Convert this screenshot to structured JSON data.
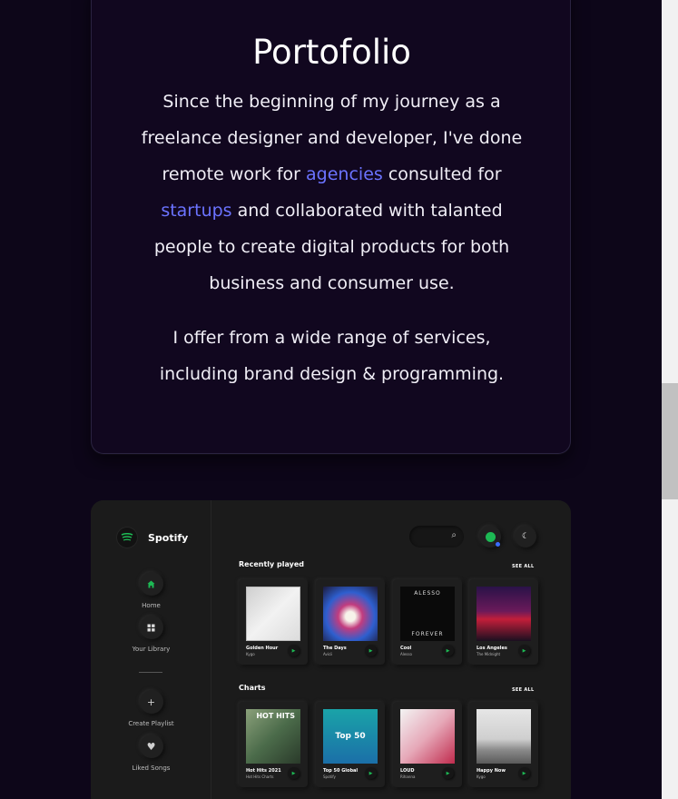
{
  "intro": {
    "title": "Portofolio",
    "p1_part1": "Since the beginning of my journey as a freelance designer and developer, I've done remote work for ",
    "link_agencies": "agencies",
    "p1_part2": " consulted for ",
    "link_startups": "startups",
    "p1_part3": " and collaborated with talanted people to create digital products for both business and consumer use.",
    "p2": "I offer from a wide range of services, including brand design & programming."
  },
  "colors": {
    "background": "#0d0619",
    "card": "#11071f",
    "link": "#6b73ff",
    "spotify_green": "#1db954",
    "mockup_bg": "#1b1b1b"
  },
  "spotify": {
    "logo_text": "Spotify",
    "logo_icon": "spotify-logo-icon",
    "nav": [
      {
        "label": "Home",
        "icon": "home-icon"
      },
      {
        "label": "Your Library",
        "icon": "library-icon"
      },
      {
        "label": "Create Playlist",
        "icon": "plus-icon"
      },
      {
        "label": "Liked Songs",
        "icon": "heart-icon"
      }
    ],
    "search_icon": "search-icon",
    "theme_icon": "moon-icon",
    "recently_played": {
      "title": "Recently played",
      "see_all": "SEE ALL",
      "items": [
        {
          "title": "Golden Hour",
          "sub": "Kygo"
        },
        {
          "title": "The Days",
          "sub": "Avicii"
        },
        {
          "title": "Cool",
          "sub": "Alesso",
          "cover_top": "ALESSO",
          "cover_bottom": "FOREVER"
        },
        {
          "title": "Los Angeles",
          "sub": "The Midnight"
        }
      ]
    },
    "charts": {
      "title": "Charts",
      "see_all": "SEE ALL",
      "items": [
        {
          "title": "Hot Hits 2021",
          "sub": "Hot Hits Charts",
          "cover_text": "HOT HITS"
        },
        {
          "title": "Top 50 Global",
          "sub": "Spotify",
          "cover_text": "Top 50"
        },
        {
          "title": "LOUD",
          "sub": "Rihanna"
        },
        {
          "title": "Happy Now",
          "sub": "Kygo"
        }
      ]
    }
  }
}
